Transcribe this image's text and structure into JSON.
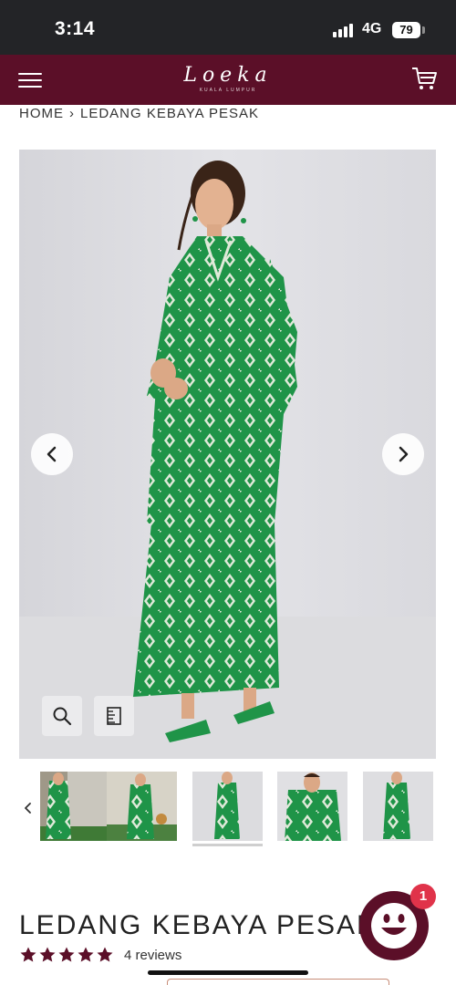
{
  "status_bar": {
    "time": "3:14",
    "network": "4G",
    "battery": "79"
  },
  "header": {
    "brand_name": "Loeka",
    "brand_tagline": "KUALA LUMPUR",
    "menu_icon": "hamburger-icon",
    "cart_icon": "cart-icon"
  },
  "breadcrumb": {
    "home": "HOME",
    "separator": "›",
    "current": "LEDANG KEBAYA PESAK"
  },
  "gallery": {
    "prev_icon": "chevron-left-icon",
    "next_icon": "chevron-right-icon",
    "zoom_icon": "search-icon",
    "size_chart_icon": "size-chart-icon",
    "thumbnails": [
      {
        "alt": "thumbnail 1"
      },
      {
        "alt": "thumbnail 2"
      },
      {
        "alt": "thumbnail 3",
        "active": true
      },
      {
        "alt": "thumbnail 4"
      },
      {
        "alt": "thumbnail 5"
      }
    ]
  },
  "product": {
    "title": "LEDANG KEBAYA PESAK",
    "rating": 5,
    "reviews_label": "4 reviews"
  },
  "chat": {
    "badge_count": "1",
    "icon": "smiley-chat-icon"
  },
  "colors": {
    "brand": "#5b0f28",
    "garment_green": "#1f9448",
    "badge": "#e0334a"
  }
}
